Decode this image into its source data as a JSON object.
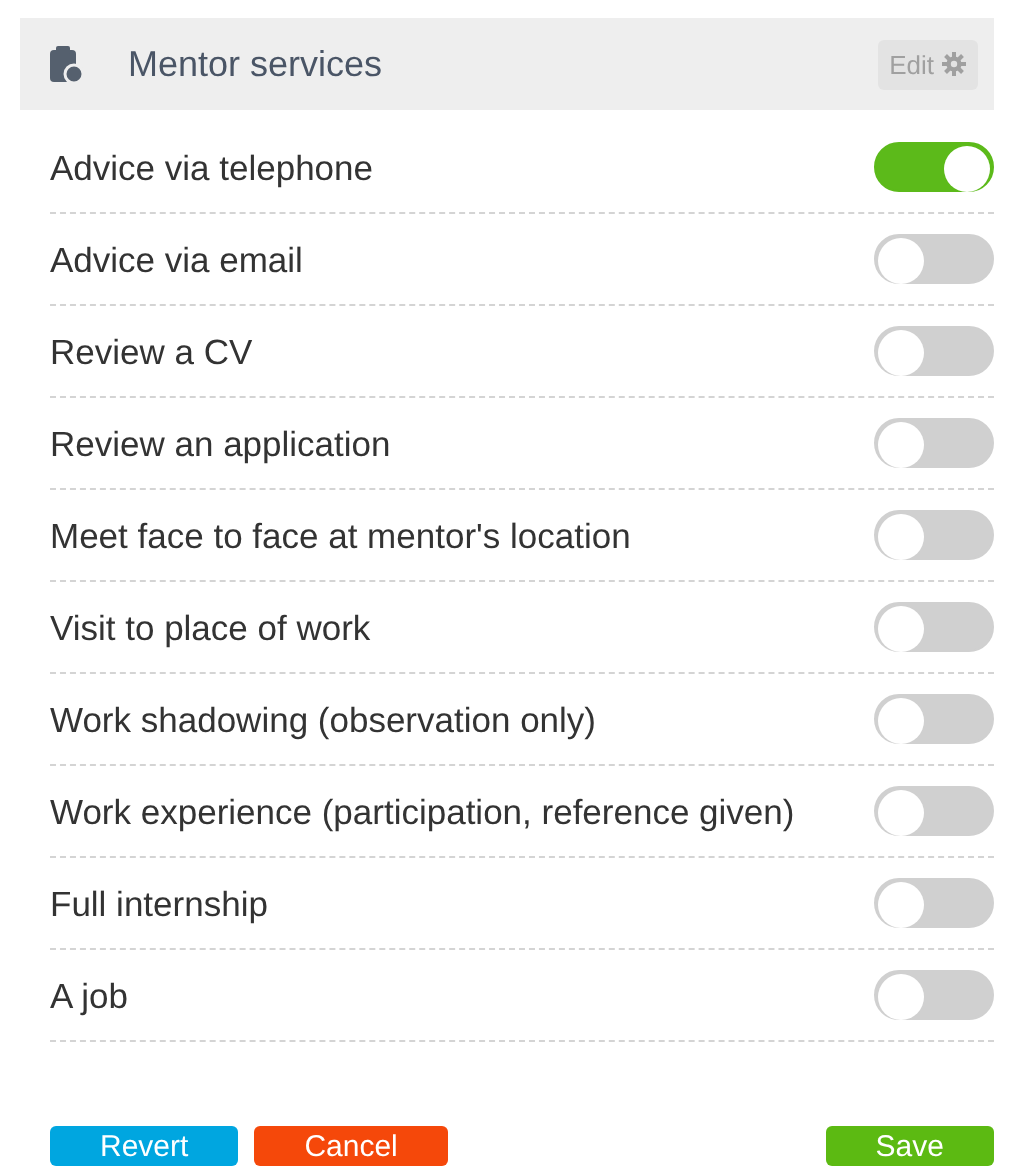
{
  "header": {
    "title": "Mentor services",
    "edit_label": "Edit"
  },
  "services": [
    {
      "label": "Advice via telephone",
      "on": true
    },
    {
      "label": "Advice via email",
      "on": false
    },
    {
      "label": "Review a CV",
      "on": false
    },
    {
      "label": "Review an application",
      "on": false
    },
    {
      "label": "Meet face to face at mentor's location",
      "on": false
    },
    {
      "label": "Visit to place of work",
      "on": false
    },
    {
      "label": "Work shadowing (observation only)",
      "on": false
    },
    {
      "label": "Work experience (participation, reference given)",
      "on": false
    },
    {
      "label": "Full internship",
      "on": false
    },
    {
      "label": "A job",
      "on": false
    }
  ],
  "buttons": [
    {
      "label": "Revert",
      "kind": "revert"
    },
    {
      "label": "Cancel",
      "kind": "cancel"
    },
    {
      "label": "Save",
      "kind": "save"
    }
  ]
}
